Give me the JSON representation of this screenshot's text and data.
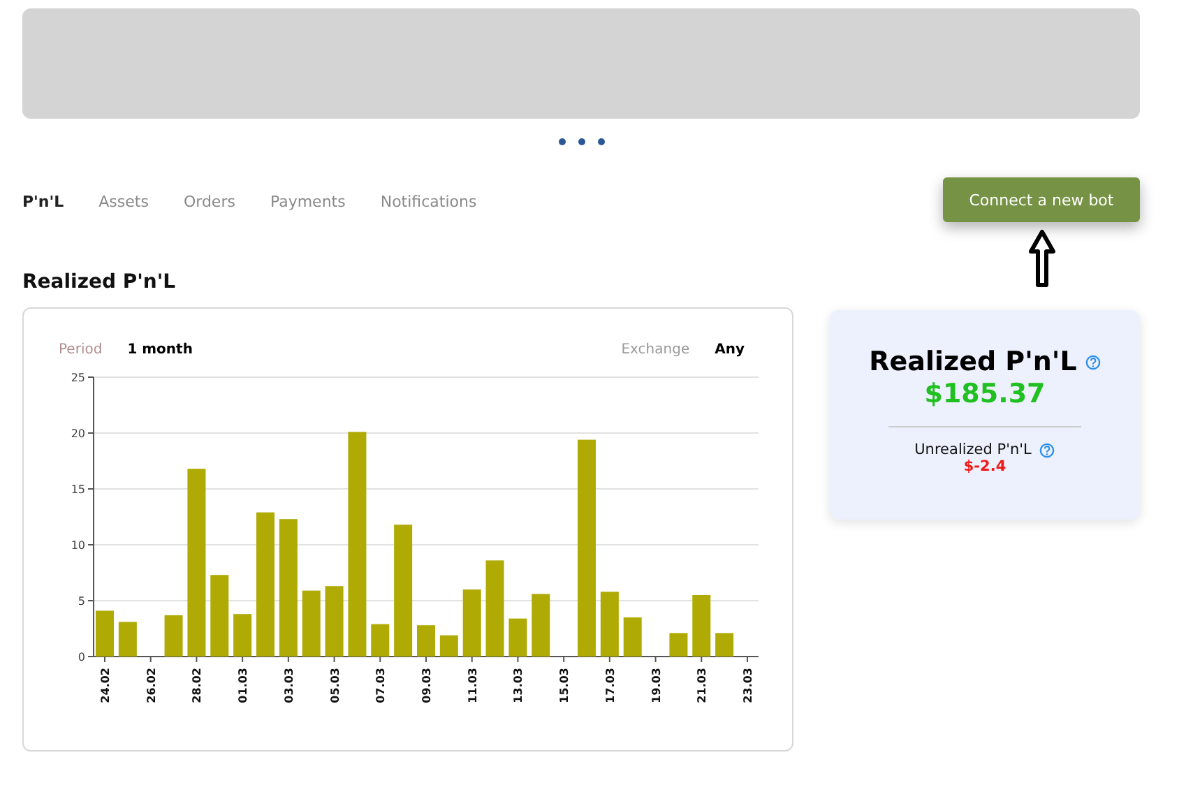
{
  "tabs": [
    {
      "label": "P'n'L",
      "selected": true
    },
    {
      "label": "Assets",
      "selected": false
    },
    {
      "label": "Orders",
      "selected": false
    },
    {
      "label": "Payments",
      "selected": false
    },
    {
      "label": "Notifications",
      "selected": false
    }
  ],
  "connect_button": "Connect a new bot",
  "section_title": "Realized P'n'L",
  "filters": [
    {
      "label": "Period",
      "value": "1 month"
    },
    {
      "label": "Exchange",
      "value": "Any"
    }
  ],
  "chart": {
    "chart_data": {
      "type": "bar",
      "grid": true,
      "categories": [
        "24.02",
        null,
        "26.02",
        null,
        "28.02",
        null,
        "01.03",
        null,
        "03.03",
        null,
        "05.03",
        null,
        "07.03",
        null,
        "09.03",
        null,
        "11.03",
        null,
        "13.03",
        null,
        "15.03",
        null,
        "17.03",
        null,
        "19.03",
        null,
        "21.03",
        null,
        "23.03"
      ],
      "series": [
        {
          "color": "#afaa04",
          "values": [
            4.1,
            3.1,
            0,
            3.7,
            16.8,
            7.3,
            3.8,
            12.9,
            12.3,
            5.9,
            6.3,
            20.1,
            2.9,
            11.8,
            2.8,
            1.9,
            6.0,
            8.6,
            3.4,
            5.6,
            0,
            19.4,
            5.8,
            3.5,
            0,
            2.1,
            5.5,
            2.1,
            0
          ]
        }
      ],
      "ylim": [
        0,
        25
      ],
      "yticks": [
        0,
        5,
        10,
        15,
        20,
        25
      ]
    }
  },
  "summary": {
    "title": "Realized P'n'L",
    "value": "$185.37",
    "unrealized_label": "Unrealized P'n'L",
    "unrealized_value": "$-2.4"
  }
}
